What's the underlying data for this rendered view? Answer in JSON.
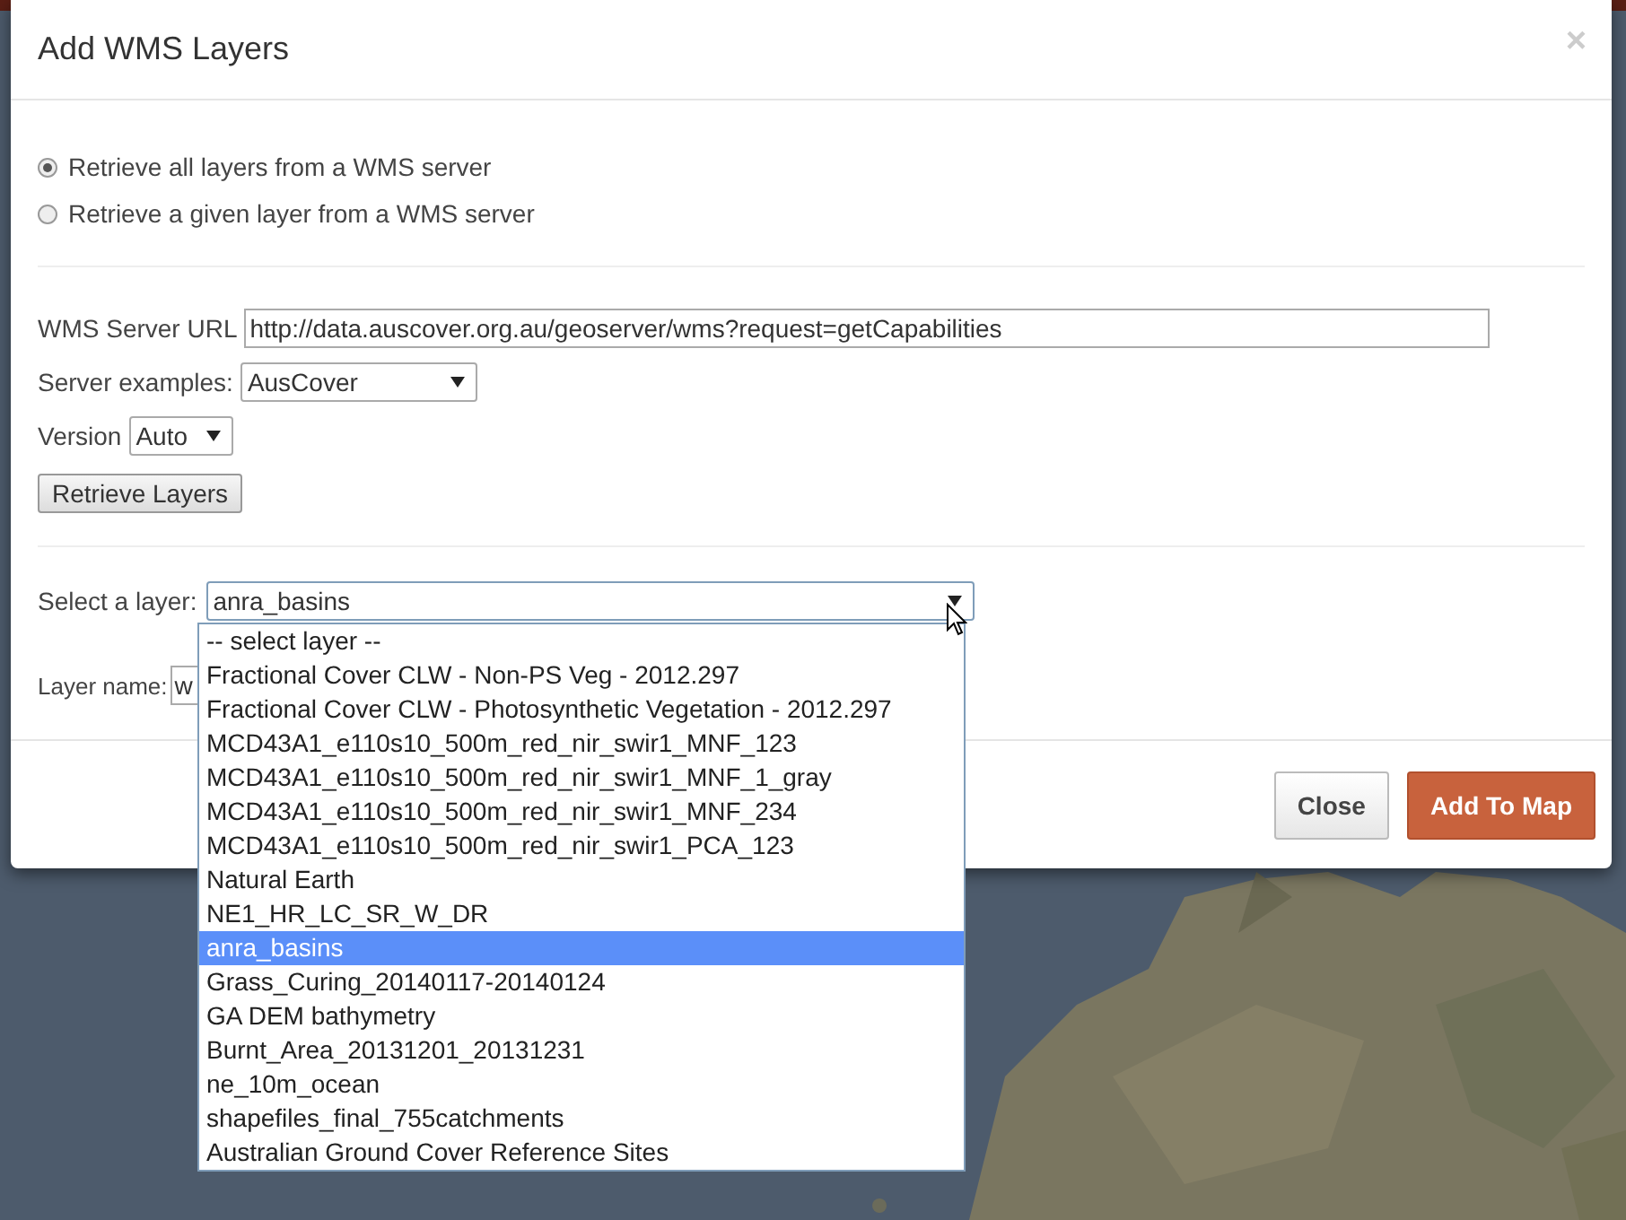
{
  "dialog": {
    "title": "Add WMS Layers",
    "close_symbol": "×"
  },
  "source_options": [
    {
      "label": "Retrieve all layers from a WMS server",
      "selected": true
    },
    {
      "label": "Retrieve a given layer from a WMS server",
      "selected": false
    }
  ],
  "server_url": {
    "label": "WMS Server URL",
    "value": "http://data.auscover.org.au/geoserver/wms?request=getCapabilities"
  },
  "server_examples": {
    "label": "Server examples:",
    "value": "AusCover"
  },
  "version": {
    "label": "Version",
    "value": "Auto"
  },
  "retrieve_button": "Retrieve Layers",
  "layer_select": {
    "label": "Select a layer:",
    "value": "anra_basins",
    "expanded": true,
    "options": [
      {
        "label": "-- select layer --",
        "selected": false
      },
      {
        "label": "Fractional Cover CLW - Non-PS Veg - 2012.297",
        "selected": false
      },
      {
        "label": "Fractional Cover CLW - Photosynthetic Vegetation - 2012.297",
        "selected": false
      },
      {
        "label": "MCD43A1_e110s10_500m_red_nir_swir1_MNF_123",
        "selected": false
      },
      {
        "label": "MCD43A1_e110s10_500m_red_nir_swir1_MNF_1_gray",
        "selected": false
      },
      {
        "label": "MCD43A1_e110s10_500m_red_nir_swir1_MNF_234",
        "selected": false
      },
      {
        "label": "MCD43A1_e110s10_500m_red_nir_swir1_PCA_123",
        "selected": false
      },
      {
        "label": "Natural Earth",
        "selected": false
      },
      {
        "label": "NE1_HR_LC_SR_W_DR",
        "selected": false
      },
      {
        "label": "anra_basins",
        "selected": true
      },
      {
        "label": "Grass_Curing_20140117-20140124",
        "selected": false
      },
      {
        "label": "GA DEM bathymetry",
        "selected": false
      },
      {
        "label": "Burnt_Area_20131201_20131231",
        "selected": false
      },
      {
        "label": "ne_10m_ocean",
        "selected": false
      },
      {
        "label": "shapefiles_final_755catchments",
        "selected": false
      },
      {
        "label": "Australian Ground Cover Reference Sites",
        "selected": false
      }
    ]
  },
  "layer_name": {
    "label": "Layer name:",
    "value": "w"
  },
  "buttons": [
    {
      "label": "Close",
      "kind": "default"
    },
    {
      "label": "Add To Map",
      "kind": "primary"
    }
  ]
}
